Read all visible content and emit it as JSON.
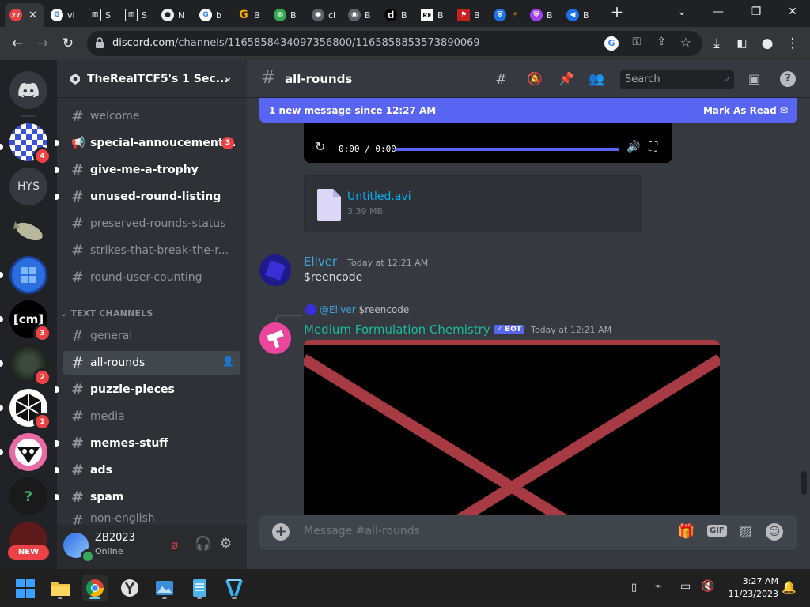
{
  "browser": {
    "tabs": [
      {
        "label": "",
        "icon": "discord-icon",
        "badge": "27",
        "active": true
      },
      {
        "label": "vi",
        "icon": "google-icon"
      },
      {
        "label": "S",
        "icon": "building-icon"
      },
      {
        "label": "S",
        "icon": "building-icon"
      },
      {
        "label": "N",
        "icon": "github-icon"
      },
      {
        "label": "b",
        "icon": "google-icon"
      },
      {
        "label": "B",
        "icon": "g-icon"
      },
      {
        "label": "B",
        "icon": "globe-icon"
      },
      {
        "label": "cl",
        "icon": "chrome-icon"
      },
      {
        "label": "B",
        "icon": "chrome-icon"
      },
      {
        "label": "B",
        "icon": "d-icon"
      },
      {
        "label": "B",
        "icon": "re-icon"
      },
      {
        "label": "B",
        "icon": "flag-icon"
      },
      {
        "label": "",
        "icon": "shield-icon"
      },
      {
        "label": "B",
        "icon": "shield-icon"
      },
      {
        "label": "B",
        "icon": "fish-icon"
      }
    ],
    "new_tab": "+",
    "url_domain": "discord.com",
    "url_path": "/channels/1165858434097356800/1165858853573890069"
  },
  "server": {
    "name": "TheRealTCF5's 1 Sec...",
    "guild_text_hys": "HYS",
    "guild_text_cm": "[cm]",
    "guild_badges": {
      "g1": "4",
      "g6": "3",
      "g7": "2",
      "g8": "1"
    },
    "new_label": "NEW"
  },
  "channels": {
    "top": [
      {
        "name": "welcome",
        "unread": false
      },
      {
        "name": "special-annoucement...",
        "unread": true,
        "badge": "3",
        "icon": "megaphone-icon"
      },
      {
        "name": "give-me-a-trophy",
        "unread": true
      },
      {
        "name": "unused-round-listing",
        "unread": true
      },
      {
        "name": "preserved-rounds-status",
        "unread": false
      },
      {
        "name": "strikes-that-break-the-r...",
        "unread": false
      },
      {
        "name": "round-user-counting",
        "unread": false
      }
    ],
    "category": "TEXT CHANNELS",
    "text": [
      {
        "name": "general",
        "unread": false
      },
      {
        "name": "all-rounds",
        "unread": false,
        "active": true
      },
      {
        "name": "puzzle-pieces",
        "unread": true
      },
      {
        "name": "media",
        "unread": false
      },
      {
        "name": "memes-stuff",
        "unread": true
      },
      {
        "name": "ads",
        "unread": true
      },
      {
        "name": "spam",
        "unread": true
      },
      {
        "name": "non-english",
        "unread": false
      }
    ]
  },
  "user": {
    "name": "ZB2023",
    "status": "Online"
  },
  "chat": {
    "channel": "all-rounds",
    "search_placeholder": "Search",
    "new_messages": "1 new message since 12:27 AM",
    "mark_read": "Mark As Read",
    "video_time": "0:00 / 0:00",
    "attachment_name": "Untitled.avi",
    "attachment_size": "3.39 MB",
    "messages": [
      {
        "author": "Eliver",
        "timestamp": "Today at 12:21 AM",
        "content": "$reencode",
        "color": "#3ba4d6"
      },
      {
        "author": "Medium Formulation Chemistry",
        "bot_tag": "BOT",
        "timestamp": "Today at 12:21 AM",
        "color": "#1abc9c",
        "reply_author": "@Eliver",
        "reply_content": "$reencode"
      }
    ],
    "composer_placeholder": "Message #all-rounds"
  },
  "taskbar": {
    "time": "3:27 AM",
    "date": "11/23/2023"
  },
  "colors": {
    "blurple": "#5865f2",
    "red": "#ed4245",
    "green": "#3ba55c"
  }
}
